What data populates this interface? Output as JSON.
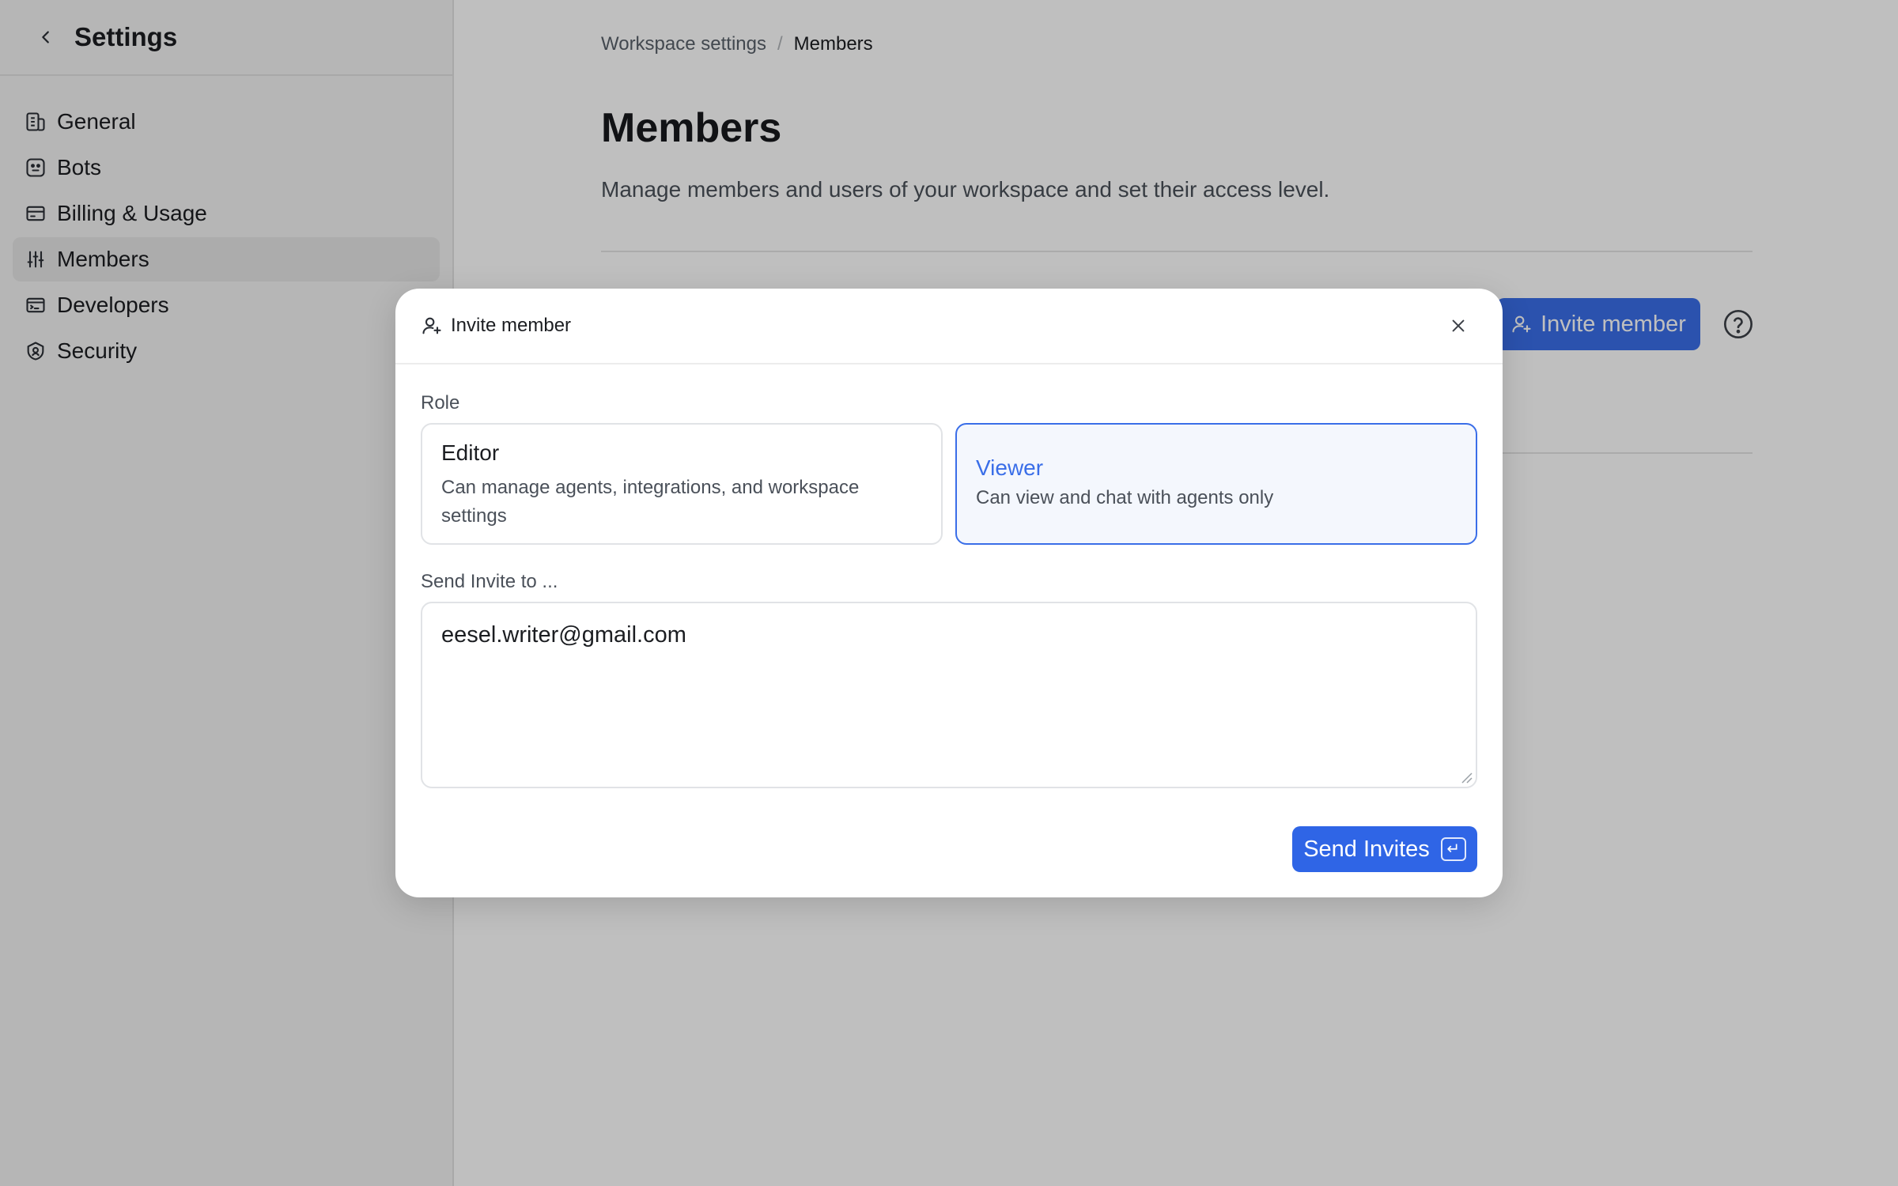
{
  "sidebar": {
    "title": "Settings",
    "items": [
      {
        "label": "General",
        "icon": "building-icon"
      },
      {
        "label": "Bots",
        "icon": "bot-icon"
      },
      {
        "label": "Billing & Usage",
        "icon": "card-icon"
      },
      {
        "label": "Members",
        "icon": "sliders-icon",
        "active": true
      },
      {
        "label": "Developers",
        "icon": "terminal-icon"
      },
      {
        "label": "Security",
        "icon": "shield-icon"
      }
    ]
  },
  "main": {
    "breadcrumb": {
      "parent": "Workspace settings",
      "separator": "/",
      "current": "Members"
    },
    "title": "Members",
    "description": "Manage members and users of your workspace and set their access level.",
    "invite_button": "Invite member"
  },
  "modal": {
    "title": "Invite member",
    "role_label": "Role",
    "roles": [
      {
        "name": "Editor",
        "description": "Can manage agents, integrations, and workspace settings",
        "selected": false
      },
      {
        "name": "Viewer",
        "description": "Can view and chat with agents only",
        "selected": true
      }
    ],
    "send_label": "Send Invite to ...",
    "email_value": "eesel.writer@gmail.com",
    "send_button": "Send Invites",
    "enter_key": "↵"
  },
  "colors": {
    "accent": "#3a6ee8",
    "overlay": "rgba(0,0,0,0.25)"
  }
}
